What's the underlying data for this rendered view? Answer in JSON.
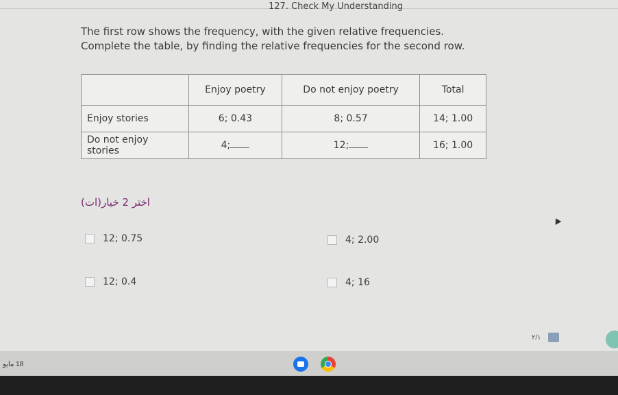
{
  "page": {
    "title": "127. Check My Understanding",
    "instructions": [
      "The first row shows the frequency, with the given relative frequencies.",
      "Complete the table, by finding the relative frequencies for the second row."
    ]
  },
  "table": {
    "headers": [
      "",
      "Enjoy poetry",
      "Do not enjoy poetry",
      "Total"
    ],
    "rows": [
      {
        "label": "Enjoy stories",
        "cells": [
          "6; 0.43",
          "8; 0.57",
          "14; 1.00"
        ]
      },
      {
        "label": "Do not enjoy stories",
        "cells": [
          "4;",
          "12;",
          "16; 1.00"
        ]
      }
    ]
  },
  "question": {
    "select_prompt": "اختر 2 خيار(ات)",
    "options": [
      "12; 0.75",
      "4; 2.00",
      "12; 0.4",
      "4; 16"
    ]
  },
  "footer": {
    "pager": "٢/١",
    "date": "18 مايو"
  },
  "icons": {
    "files_app": "files-icon",
    "chrome_app": "chrome-icon"
  }
}
